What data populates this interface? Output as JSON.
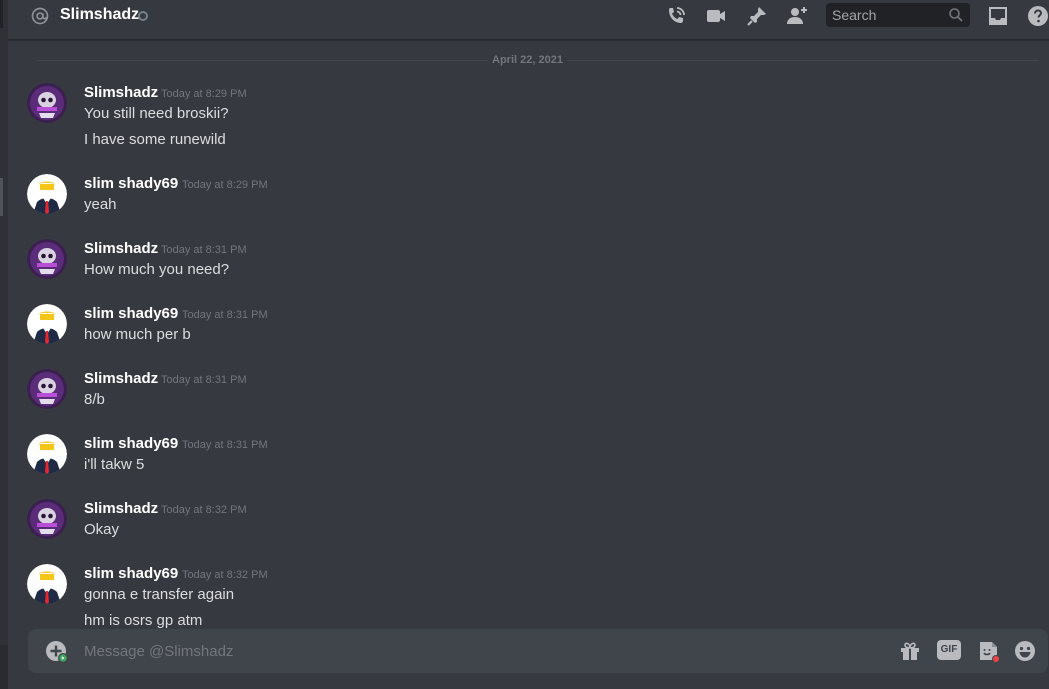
{
  "header": {
    "channel_name": "Slimshadz",
    "search_placeholder": "Search"
  },
  "divider": {
    "date": "April 22, 2021"
  },
  "messages": [
    {
      "author": "Slimshadz",
      "timestamp": "Today at 8:29 PM",
      "lines": [
        "You still need broskii?",
        "I have some runewild"
      ],
      "avatar": "skull-avatar"
    },
    {
      "author": "slim shady69",
      "timestamp": "Today at 8:29 PM",
      "lines": [
        "yeah"
      ],
      "avatar": "suit-avatar"
    },
    {
      "author": "Slimshadz",
      "timestamp": "Today at 8:31 PM",
      "lines": [
        "How much you need?"
      ],
      "avatar": "skull-avatar"
    },
    {
      "author": "slim shady69",
      "timestamp": "Today at 8:31 PM",
      "lines": [
        "how much per b"
      ],
      "avatar": "suit-avatar"
    },
    {
      "author": "Slimshadz",
      "timestamp": "Today at 8:31 PM",
      "lines": [
        "8/b"
      ],
      "avatar": "skull-avatar"
    },
    {
      "author": "slim shady69",
      "timestamp": "Today at 8:31 PM",
      "lines": [
        "i'll takw 5"
      ],
      "avatar": "suit-avatar"
    },
    {
      "author": "Slimshadz",
      "timestamp": "Today at 8:32 PM",
      "lines": [
        "Okay"
      ],
      "avatar": "skull-avatar"
    },
    {
      "author": "slim shady69",
      "timestamp": "Today at 8:32 PM",
      "lines": [
        "gonna e transfer again",
        "hm is osrs gp atm"
      ],
      "avatar": "suit-avatar"
    }
  ],
  "composer": {
    "placeholder": "Message @Slimshadz",
    "gif_label": "GIF"
  },
  "colors": {
    "background": "#36393f",
    "composer": "#40444b",
    "text": "#dcddde",
    "muted": "#72767d",
    "online_badge": "#3ba55c",
    "notification_dot": "#ed4245"
  }
}
